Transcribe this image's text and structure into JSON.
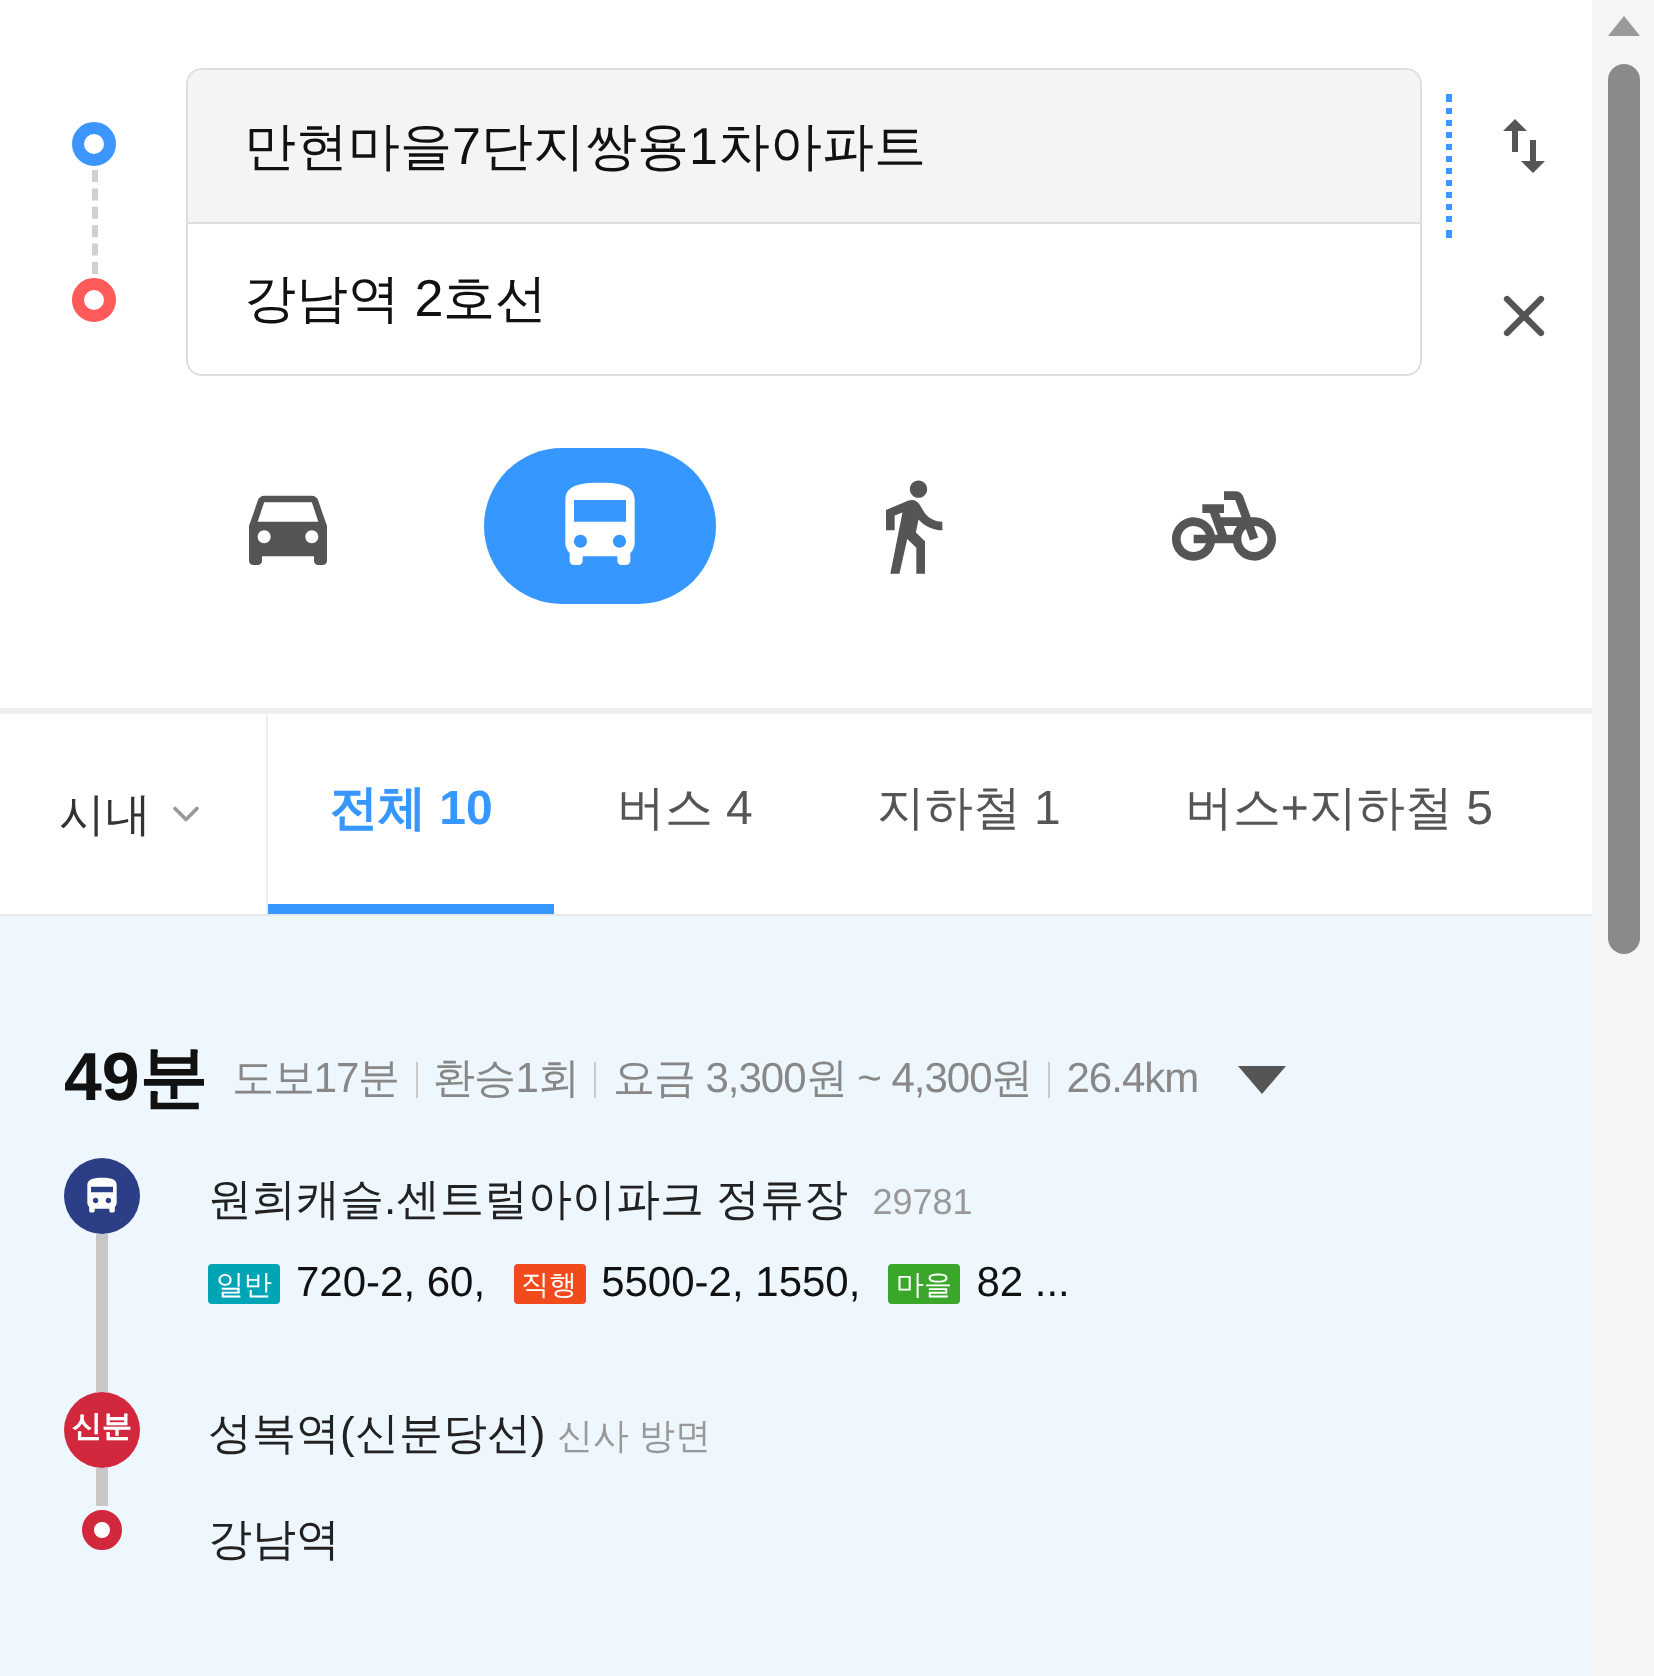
{
  "route": {
    "origin": "만현마을7단지쌍용1차아파트",
    "destination": "강남역 2호선"
  },
  "modes": [
    {
      "kind": "car",
      "selected": false
    },
    {
      "kind": "bus",
      "selected": true
    },
    {
      "kind": "walk",
      "selected": false
    },
    {
      "kind": "bike",
      "selected": false
    }
  ],
  "region_filter": "시내",
  "tabs": [
    {
      "label": "전체 10",
      "selected": true
    },
    {
      "label": "버스 4",
      "selected": false
    },
    {
      "label": "지하철 1",
      "selected": false
    },
    {
      "label": "버스+지하철 5",
      "selected": false
    }
  ],
  "result": {
    "time": "49분",
    "details": [
      "도보17분",
      "환승1회",
      "요금 3,300원 ~ 4,300원",
      "26.4km"
    ],
    "steps": [
      {
        "kind": "bus",
        "color": "#2c3f86",
        "name": "원희캐슬.센트럴아이파크 정류장",
        "code": "29781",
        "lines": [
          {
            "type": "일반",
            "color": "#00a5b5",
            "numbers": "720-2, 60,"
          },
          {
            "type": "직행",
            "color": "#f04a1d",
            "numbers": "5500-2, 1550,"
          },
          {
            "type": "마을",
            "color": "#3aa72b",
            "numbers": "82 ..."
          }
        ]
      },
      {
        "kind": "subway",
        "color": "#d2283e",
        "badge": "신분",
        "name": "성복역(신분당선)",
        "direction": "신사 방면"
      },
      {
        "kind": "end",
        "color": "#d2283e",
        "name": "강남역"
      }
    ]
  }
}
